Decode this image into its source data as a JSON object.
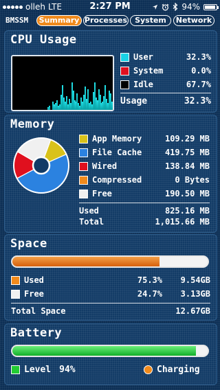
{
  "status_bar": {
    "carrier": "olleh",
    "network": "LTE",
    "time": "2:27 PM",
    "battery_pct": "94%",
    "signal_icon": "signal-dots-icon",
    "location_icon": "location-arrow-icon",
    "alarm_icon": "alarm-clock-icon",
    "bluetooth_icon": "bluetooth-icon",
    "battery_level": 0.94
  },
  "app": {
    "name": "BMSSM",
    "tabs": [
      {
        "label": "Summary",
        "active": true
      },
      {
        "label": "Processes",
        "active": false
      },
      {
        "label": "System",
        "active": false
      },
      {
        "label": "Network",
        "active": false
      }
    ]
  },
  "cpu": {
    "title": "CPU Usage",
    "legend": [
      {
        "label": "User",
        "value": "32.3%",
        "color": "#19d2e6"
      },
      {
        "label": "System",
        "value": "0.0%",
        "color": "#e01020"
      },
      {
        "label": "Idle",
        "value": "67.7%",
        "color": "#000000"
      }
    ],
    "usage_label": "Usage",
    "usage_value": "32.3%"
  },
  "memory": {
    "title": "Memory",
    "legend": [
      {
        "label": "App Memory",
        "value": "109.29 MB",
        "color": "#d9c21a"
      },
      {
        "label": "File Cache",
        "value": "419.75 MB",
        "color": "#2b82e0"
      },
      {
        "label": "Wired",
        "value": "138.84 MB",
        "color": "#e0101e"
      },
      {
        "label": "Compressed",
        "value": "0 Bytes",
        "color": "#f08a1c"
      },
      {
        "label": "Free",
        "value": "190.50 MB",
        "color": "#f0f0f0"
      }
    ],
    "pie_values": [
      109.29,
      419.75,
      138.84,
      0,
      190.5
    ],
    "used_label": "Used",
    "used_value": "825.16 MB",
    "total_label": "Total",
    "total_value": "1,015.66 MB"
  },
  "space": {
    "title": "Space",
    "used_fraction": 0.753,
    "legend": [
      {
        "label": "Used",
        "pct": "75.3%",
        "value": "9.54GB",
        "color": "#f08a1c"
      },
      {
        "label": "Free",
        "pct": "24.7%",
        "value": "3.13GB",
        "color": "#f0f0f0"
      }
    ],
    "total_label": "Total Space",
    "total_value": "12.67GB"
  },
  "battery": {
    "title": "Battery",
    "level_fraction": 0.94,
    "level_label": "Level",
    "level_value": "94%",
    "level_color": "#22cc33",
    "charging_label": "Charging",
    "charging_color": "#f08a1c"
  }
}
